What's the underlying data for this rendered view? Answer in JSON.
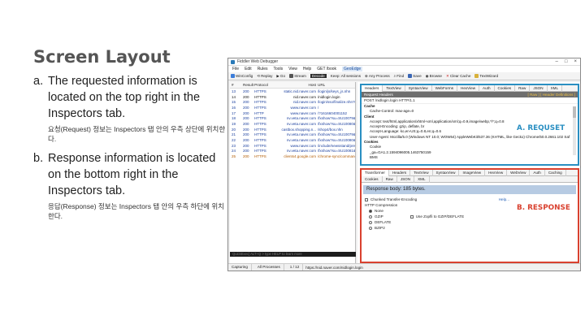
{
  "slide": {
    "title": "Screen Layout",
    "bullets": [
      {
        "letter": "a.",
        "text": "The requested information is located on the top right in the Inspectors tab.",
        "sub": "요청(Request) 정보는 Inspectors 탭 안의 우측 상단에 위치한다."
      },
      {
        "letter": "b.",
        "text": "Response information is located on the bottom right in the Inspectors tab.",
        "sub": "응답(Response) 정보는 Inspectors 탭 안의 우측 하단에 위치한다."
      }
    ]
  },
  "window": {
    "title": "Fiddler Web Debugger",
    "controls": [
      "–",
      "□",
      "×"
    ],
    "menu": [
      "File",
      "Edit",
      "Rules",
      "Tools",
      "View",
      "Help",
      "GET /book",
      "GeoEdge"
    ],
    "toolbar": [
      "WinConfig",
      "Replay",
      "Go",
      "Stream",
      "Decode",
      "Keep: All sessions",
      "Any Process",
      "Find",
      "Save",
      "Browse",
      "Clear Cache",
      "TextWizard"
    ]
  },
  "sessions": {
    "columns": [
      "#",
      "Result",
      "Protocol",
      "Host",
      "URL"
    ],
    "rows": [
      {
        "num": "13",
        "result": "200",
        "protocol": "HTTPS",
        "host": "static.nid.naver.com",
        "url": "/login/js/keys_js.nhn",
        "style": ""
      },
      {
        "num": "14",
        "result": "200",
        "protocol": "HTTPS",
        "host": "nid.naver.com",
        "url": "/nidlogin.login",
        "style": "black"
      },
      {
        "num": "15",
        "result": "200",
        "protocol": "HTTPS",
        "host": "nid.naver.com",
        "url": "/login/sso/finalize.nhn?url...",
        "style": ""
      },
      {
        "num": "16",
        "result": "200",
        "protocol": "HTTPS",
        "host": "www.naver.com",
        "url": "/",
        "style": ""
      },
      {
        "num": "17",
        "result": "200",
        "protocol": "HTTP",
        "host": "www.naver.com",
        "url": "/?1616604001152",
        "style": ""
      },
      {
        "num": "18",
        "result": "200",
        "protocol": "HTTPS",
        "host": "nv.veta.naver.com",
        "url": "/fxshow?su=SU10079&nrefreshx=0",
        "style": ""
      },
      {
        "num": "19",
        "result": "200",
        "protocol": "HTTPS",
        "host": "nv.veta.naver.com",
        "url": "/fxshow?su=SU10080&nrefreshx=0",
        "style": ""
      },
      {
        "num": "20",
        "result": "200",
        "protocol": "HTTPS",
        "host": "castbox.shopping.n...",
        "url": "/shop4/box.nhn",
        "style": ""
      },
      {
        "num": "21",
        "result": "200",
        "protocol": "HTTPS",
        "host": "nv.veta.naver.com",
        "url": "/fxshow?su=SU10079&nrefreshx=0",
        "style": ""
      },
      {
        "num": "22",
        "result": "200",
        "protocol": "HTTPS",
        "host": "nv.veta.naver.com",
        "url": "/fxshow?su=SU10080&nrefreshx=0",
        "style": ""
      },
      {
        "num": "23",
        "result": "200",
        "protocol": "HTTPS",
        "host": "www.naver.com",
        "url": "/include/newsstand/press...",
        "style": ""
      },
      {
        "num": "24",
        "result": "200",
        "protocol": "HTTPS",
        "host": "nv.veta.naver.com",
        "url": "/fxshow?su=SU10081&nrefreshx=0",
        "style": ""
      },
      {
        "num": "25",
        "result": "200",
        "protocol": "HTTPS",
        "host": "clients4.google.com",
        "url": "/chrome-sync/command/?...",
        "style": "orange"
      }
    ],
    "quickexec": "QuickExec] ALT+Q > type HELP to learn more"
  },
  "statusbar": {
    "capture": "Capturing",
    "processes": "All Processes",
    "count": "1 / 12",
    "url": "https://nid.naver.com/nidlogin.login"
  },
  "inspector": {
    "top_tabs": [
      "Statistics",
      "Inspectors",
      "AutoResponder",
      "Composer",
      "FiddlerScript",
      "Log",
      "Filters",
      "Timeline"
    ],
    "request_tabs": [
      "Headers",
      "TextView",
      "SyntaxView",
      "WebForms",
      "HexView",
      "Auth",
      "Cookies",
      "Raw",
      "JSON",
      "XML"
    ],
    "request_header_title": "Request Headers",
    "request_header_links": "[ Raw ] [ Header Definitions ]",
    "request_line": "POST /nidlogin.login HTTP/1.1",
    "request_groups": [
      {
        "name": "Cache",
        "items": [
          "Cache-Control: max-age=0"
        ]
      },
      {
        "name": "Client",
        "items": [
          "Accept: text/html,application/xhtml+xml,application/xml;q=0.9,image/webp,*/*;q=0.8",
          "Accept-Encoding: gzip, deflate, br",
          "Accept-Language: ko,en-US;q=0.8,en;q=0.6",
          "User-Agent: Mozilla/5.0 (Windows NT 10.0; WOW64) AppleWebKit/537.36 (KHTML, like Gecko) Chrome/50.0.2661.102 Saf"
        ]
      },
      {
        "name": "Cookies",
        "items": [
          "Cookie",
          "_ga=GA1.2.1594096005.1463750159",
          "BMS"
        ]
      }
    ],
    "request_label": "A. REQUSET",
    "response_tabs": [
      "Transformer",
      "Headers",
      "TextView",
      "SyntaxView",
      "ImageView",
      "HexView",
      "WebView",
      "Auth",
      "Caching"
    ],
    "response_tabs2": [
      "Cookies",
      "Raw",
      "JSON",
      "XML"
    ],
    "response_banner": "Response body: 185 bytes.",
    "chunked_label": "Chunked Transfer-Encoding",
    "help_label": "Help...",
    "compression_label": "HTTP Compression",
    "compression_options": [
      "None",
      "GZIP",
      "DEFLATE",
      "BZIP2"
    ],
    "zopfli_label": "Use Zopfli to GZIP/DEFLATE",
    "response_label": "B. RESPONSE"
  },
  "colors": {
    "request_accent": "#2a8fc2",
    "response_accent": "#d9412f"
  }
}
